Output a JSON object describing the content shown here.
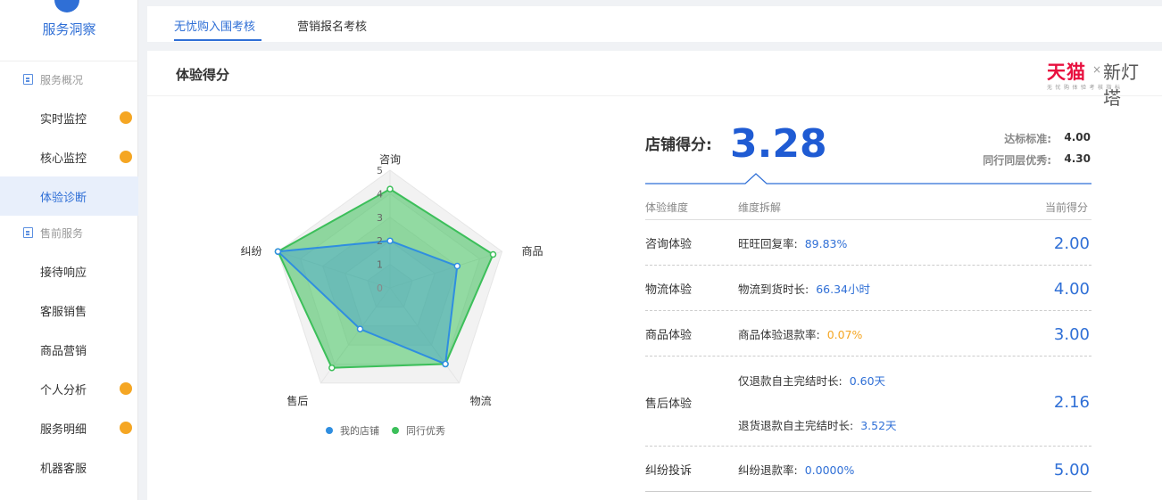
{
  "sidebar": {
    "brand_title": "服务洞察",
    "groups": [
      {
        "label": "服务概况"
      },
      {
        "label": "售前服务"
      }
    ],
    "items": [
      {
        "label": "实时监控",
        "badge": true
      },
      {
        "label": "核心监控",
        "badge": true
      },
      {
        "label": "体验诊断",
        "active": true
      },
      {
        "label": "接待响应"
      },
      {
        "label": "客服销售"
      },
      {
        "label": "商品营销"
      },
      {
        "label": "个人分析",
        "badge": true
      },
      {
        "label": "服务明细",
        "badge": true
      },
      {
        "label": "机器客服"
      }
    ]
  },
  "tabs": [
    {
      "label": "无忧购入围考核",
      "active": true
    },
    {
      "label": "营销报名考核"
    }
  ],
  "panel": {
    "title": "体验得分",
    "logo": {
      "tmall": "天猫",
      "x": "×",
      "xin": "新灯塔",
      "sub": "无忧购体验考核指标"
    }
  },
  "radar": {
    "axes": [
      "咨询",
      "商品",
      "物流",
      "售后",
      "纠纷"
    ],
    "ticks": [
      "0",
      "1",
      "2",
      "3",
      "4",
      "5"
    ],
    "max": 5,
    "series": [
      {
        "name": "我的店铺",
        "color": "#2f8ee0",
        "values": [
          2.0,
          3.0,
          4.0,
          2.16,
          5.0
        ]
      },
      {
        "name": "同行优秀",
        "color": "#3cbf5a",
        "values": [
          4.2,
          4.6,
          4.0,
          4.2,
          5.0
        ]
      }
    ]
  },
  "score": {
    "label": "店铺得分:",
    "value": "3.28",
    "standards": [
      {
        "label": "达标标准:",
        "value": "4.00"
      },
      {
        "label": "同行同层优秀:",
        "value": "4.30"
      }
    ]
  },
  "table": {
    "headers": {
      "dim": "体验维度",
      "metric": "维度拆解",
      "score": "当前得分"
    },
    "rows": [
      {
        "dim": "咨询体验",
        "metrics": [
          {
            "label": "旺旺回复率:",
            "value": "89.83%"
          }
        ],
        "score": "2.00"
      },
      {
        "dim": "物流体验",
        "metrics": [
          {
            "label": "物流到货时长:",
            "value": "66.34小时"
          }
        ],
        "score": "4.00"
      },
      {
        "dim": "商品体验",
        "metrics": [
          {
            "label": "商品体验退款率:",
            "value": "0.07%",
            "warn": true
          }
        ],
        "score": "3.00"
      },
      {
        "dim": "售后体验",
        "metrics": [
          {
            "label": "仅退款自主完结时长:",
            "value": "0.60天"
          },
          {
            "label": "退货退款自主完结时长:",
            "value": "3.52天"
          }
        ],
        "score": "2.16"
      },
      {
        "dim": "纠纷投诉",
        "metrics": [
          {
            "label": "纠纷退款率:",
            "value": "0.0000%"
          }
        ],
        "score": "5.00"
      }
    ]
  }
}
